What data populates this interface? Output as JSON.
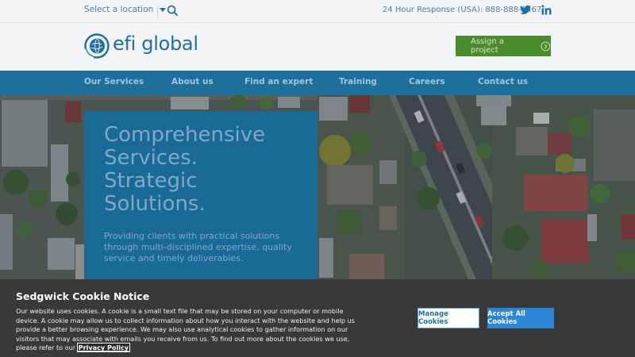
{
  "topbar": {
    "location_label": "Select a location",
    "phone": "24 Hour Response (USA): 888-888-2467"
  },
  "brand": {
    "name": "efi global",
    "assign_label": "Assign a project"
  },
  "nav": {
    "items": [
      {
        "label": "Our Services"
      },
      {
        "label": "About us"
      },
      {
        "label": "Find an expert"
      },
      {
        "label": "Training"
      },
      {
        "label": "Careers"
      },
      {
        "label": "Contact us"
      }
    ]
  },
  "hero": {
    "title_lines": [
      "Comprehensive",
      "Services.",
      "Strategic",
      "Solutions."
    ],
    "subtitle": "Providing clients with practical solutions through multi-disciplined expertise, quality service and timely deliverables."
  },
  "cookie": {
    "title": "Sedgwick Cookie Notice",
    "text": "Our website uses cookies. A cookie is a small text file that may be stored on your computer or mobile device. A cookie may allow us to collect information about how you interact with the website and help us provide a better browsing experience. We may also use analytical cookies to gather information on our visitors that may associate with emails you receive from us. To find out more about the cookies we use, please refer to our",
    "policy_link": "Privacy Policy",
    "manage_label": "Manage Cookies",
    "accept_label": "Accept All Cookies"
  },
  "colors": {
    "brand_blue": "#1e6f9c",
    "accent_green": "#4a8c2c",
    "cookie_bg": "#393939",
    "accept_blue": "#2b86d6"
  },
  "icons": {
    "location_caret": "caret-down-icon",
    "search": "search-icon",
    "twitter": "twitter-icon",
    "linkedin": "linkedin-icon",
    "assign_arrow": "arrow-circle-right-icon",
    "logo": "globe-logo-icon"
  }
}
